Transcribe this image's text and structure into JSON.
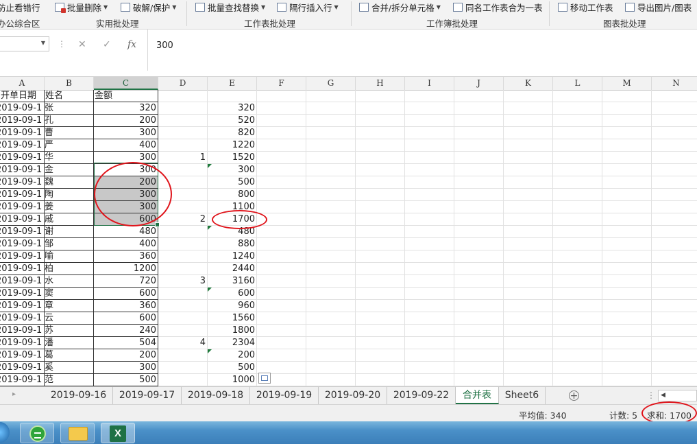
{
  "ribbon": {
    "items": [
      {
        "label": "防止看错行",
        "caret": false
      },
      {
        "label": "批量删除",
        "caret": true
      },
      {
        "label": "破解/保护",
        "caret": true
      },
      {
        "label": "批量查找替换",
        "caret": true
      },
      {
        "label": "隔行插入行",
        "caret": true
      },
      {
        "label": "合并/拆分单元格",
        "caret": true
      },
      {
        "label": "同名工作表合为一表",
        "caret": false
      },
      {
        "label": "移动工作表",
        "caret": false
      },
      {
        "label": "导出图片/图表",
        "caret": false
      }
    ],
    "groups": [
      "办公综合区",
      "实用批处理",
      "工作表批处理",
      "工作簿批处理",
      "图表批处理"
    ]
  },
  "formula_bar": {
    "cancel": "✕",
    "enter": "✓",
    "fx": "fx",
    "value": "300"
  },
  "columns": [
    "A",
    "B",
    "C",
    "D",
    "E",
    "F",
    "G",
    "H",
    "I",
    "J",
    "K",
    "L",
    "M",
    "N"
  ],
  "header_row": {
    "a": "开单日期",
    "b": "姓名",
    "c": "金额"
  },
  "rows": [
    {
      "a": "2019-09-1",
      "b": "张",
      "c": "320",
      "d": "",
      "e": "320"
    },
    {
      "a": "2019-09-1",
      "b": "孔",
      "c": "200",
      "d": "",
      "e": "520"
    },
    {
      "a": "2019-09-1",
      "b": "曹",
      "c": "300",
      "d": "",
      "e": "820"
    },
    {
      "a": "2019-09-1",
      "b": "严",
      "c": "400",
      "d": "",
      "e": "1220"
    },
    {
      "a": "2019-09-1",
      "b": "华",
      "c": "300",
      "d": "1",
      "e": "1520"
    },
    {
      "a": "2019-09-1",
      "b": "金",
      "c": "300",
      "d": "",
      "e": "300"
    },
    {
      "a": "2019-09-1",
      "b": "魏",
      "c": "200",
      "d": "",
      "e": "500"
    },
    {
      "a": "2019-09-1",
      "b": "陶",
      "c": "300",
      "d": "",
      "e": "800"
    },
    {
      "a": "2019-09-1",
      "b": "姜",
      "c": "300",
      "d": "",
      "e": "1100"
    },
    {
      "a": "2019-09-1",
      "b": "戚",
      "c": "600",
      "d": "2",
      "e": "1700"
    },
    {
      "a": "2019-09-1",
      "b": "谢",
      "c": "480",
      "d": "",
      "e": "480"
    },
    {
      "a": "2019-09-1",
      "b": "邹",
      "c": "400",
      "d": "",
      "e": "880"
    },
    {
      "a": "2019-09-1",
      "b": "喻",
      "c": "360",
      "d": "",
      "e": "1240"
    },
    {
      "a": "2019-09-1",
      "b": "柏",
      "c": "1200",
      "d": "",
      "e": "2440"
    },
    {
      "a": "2019-09-1",
      "b": "水",
      "c": "720",
      "d": "3",
      "e": "3160"
    },
    {
      "a": "2019-09-1",
      "b": "窦",
      "c": "600",
      "d": "",
      "e": "600"
    },
    {
      "a": "2019-09-1",
      "b": "章",
      "c": "360",
      "d": "",
      "e": "960"
    },
    {
      "a": "2019-09-1",
      "b": "云",
      "c": "600",
      "d": "",
      "e": "1560"
    },
    {
      "a": "2019-09-1",
      "b": "苏",
      "c": "240",
      "d": "",
      "e": "1800"
    },
    {
      "a": "2019-09-1",
      "b": "潘",
      "c": "504",
      "d": "4",
      "e": "2304"
    },
    {
      "a": "2019-09-1",
      "b": "葛",
      "c": "200",
      "d": "",
      "e": "200"
    },
    {
      "a": "2019-09-1",
      "b": "奚",
      "c": "300",
      "d": "",
      "e": "500"
    },
    {
      "a": "2019-09-1",
      "b": "范",
      "c": "500",
      "d": "",
      "e": "1000"
    }
  ],
  "sheet_tabs": [
    "2019-09-16",
    "2019-09-17",
    "2019-09-18",
    "2019-09-19",
    "2019-09-20",
    "2019-09-22",
    "合并表",
    "Sheet6"
  ],
  "active_tab": "合并表",
  "status": {
    "average": "平均值: 340",
    "count": "计数: 5",
    "sum": "求和: 1700"
  },
  "colors": {
    "accent": "#217346",
    "annotation": "#e0141b",
    "selection_fill": "#c8c8c8"
  }
}
